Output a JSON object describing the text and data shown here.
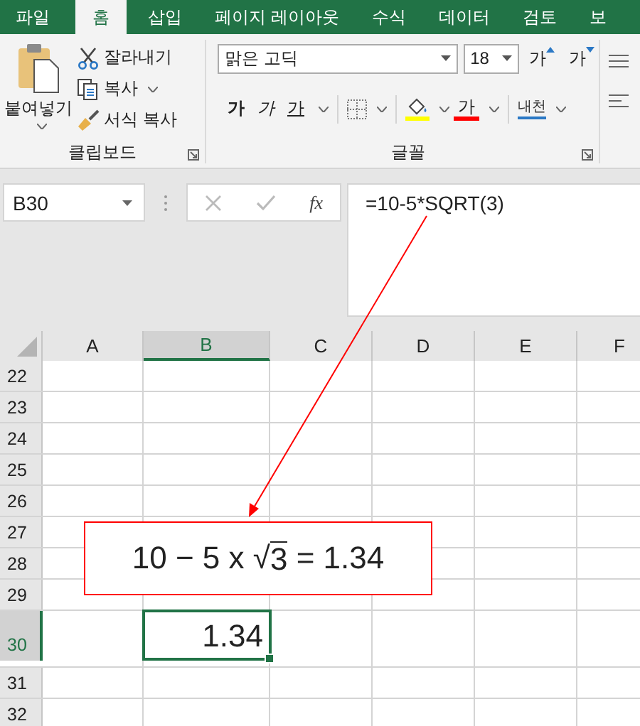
{
  "ribbon_tabs": [
    {
      "label": "파일",
      "selected": false
    },
    {
      "label": "홈",
      "selected": true
    },
    {
      "label": "삽입",
      "selected": false
    },
    {
      "label": "페이지 레이아웃",
      "selected": false
    },
    {
      "label": "수식",
      "selected": false
    },
    {
      "label": "데이터",
      "selected": false
    },
    {
      "label": "검토",
      "selected": false
    },
    {
      "label": "보",
      "selected": false
    }
  ],
  "clipboard": {
    "paste": "붙여넣기",
    "cut": "잘라내기",
    "copy": "복사",
    "format_painter": "서식 복사",
    "group_label": "클립보드"
  },
  "font": {
    "name": "맑은 고딕",
    "size": "18",
    "grow": "가",
    "shrink": "가",
    "bold": "가",
    "italic": "가",
    "underline": "가",
    "font_color": "가",
    "phonetic": "내천",
    "group_label": "글꼴"
  },
  "name_box": "B30",
  "function_button": "fx",
  "formula": "=10-5*SQRT(3)",
  "columns": [
    {
      "label": "A",
      "selected": false
    },
    {
      "label": "B",
      "selected": true
    },
    {
      "label": "C",
      "selected": false
    },
    {
      "label": "D",
      "selected": false
    },
    {
      "label": "E",
      "selected": false
    },
    {
      "label": "F",
      "selected": false
    }
  ],
  "rows": [
    {
      "label": "22",
      "selected": false
    },
    {
      "label": "23",
      "selected": false
    },
    {
      "label": "24",
      "selected": false
    },
    {
      "label": "25",
      "selected": false
    },
    {
      "label": "26",
      "selected": false
    },
    {
      "label": "27",
      "selected": false
    },
    {
      "label": "28",
      "selected": false
    },
    {
      "label": "29",
      "selected": false
    },
    {
      "label": "30",
      "selected": true
    },
    {
      "label": "31",
      "selected": false
    },
    {
      "label": "32",
      "selected": false
    }
  ],
  "active_cell": {
    "value": "1.34"
  },
  "callout": {
    "before": "10 − 5 x √",
    "radicand": "3",
    "after": " = 1.34"
  }
}
